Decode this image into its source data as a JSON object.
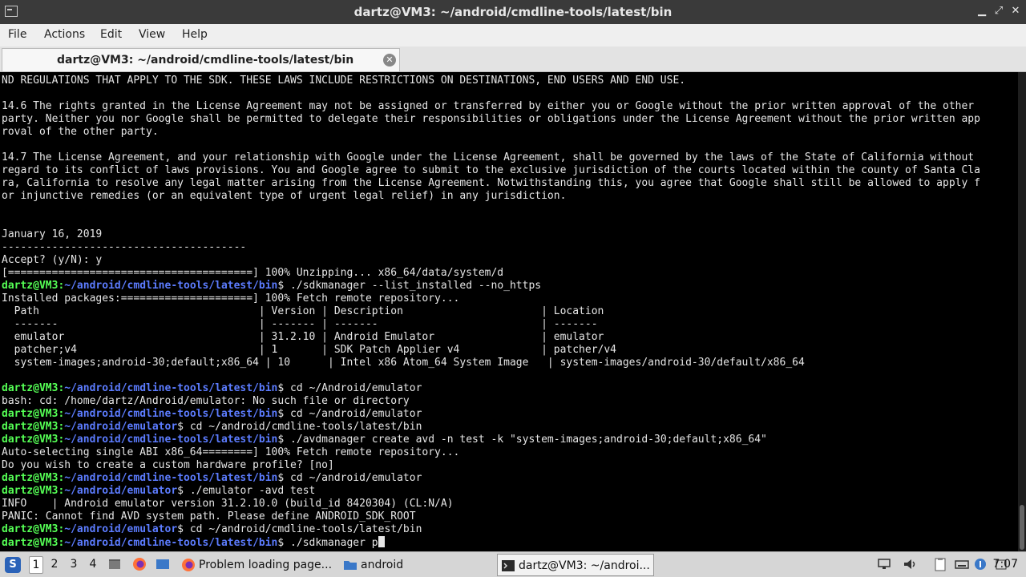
{
  "window": {
    "title": "dartz@VM3: ~/android/cmdline-tools/latest/bin",
    "minimize": "▁",
    "maximize": "⤢",
    "close": "✕"
  },
  "menu": [
    "File",
    "Actions",
    "Edit",
    "View",
    "Help"
  ],
  "tab": {
    "label": "dartz@VM3: ~/android/cmdline-tools/latest/bin",
    "close": "✕"
  },
  "terminal": {
    "lines": [
      {
        "text": "ND REGULATIONS THAT APPLY TO THE SDK. THESE LAWS INCLUDE RESTRICTIONS ON DESTINATIONS, END USERS AND END USE."
      },
      {
        "text": ""
      },
      {
        "text": "14.6 The rights granted in the License Agreement may not be assigned or transferred by either you or Google without the prior written approval of the other"
      },
      {
        "text": "party. Neither you nor Google shall be permitted to delegate their responsibilities or obligations under the License Agreement without the prior written app"
      },
      {
        "text": "roval of the other party."
      },
      {
        "text": ""
      },
      {
        "text": "14.7 The License Agreement, and your relationship with Google under the License Agreement, shall be governed by the laws of the State of California without"
      },
      {
        "text": "regard to its conflict of laws provisions. You and Google agree to submit to the exclusive jurisdiction of the courts located within the county of Santa Cla"
      },
      {
        "text": "ra, California to resolve any legal matter arising from the License Agreement. Notwithstanding this, you agree that Google shall still be allowed to apply f"
      },
      {
        "text": "or injunctive remedies (or an equivalent type of urgent legal relief) in any jurisdiction."
      },
      {
        "text": ""
      },
      {
        "text": ""
      },
      {
        "text": "January 16, 2019"
      },
      {
        "text": "---------------------------------------"
      },
      {
        "text": "Accept? (y/N): y"
      },
      {
        "text": "[=======================================] 100% Unzipping... x86_64/data/system/d"
      },
      {
        "prompt": "dartz@VM3",
        "path": "~/android/cmdline-tools/latest/bin",
        "text": "$ ./sdkmanager --list_installed --no_https"
      },
      {
        "text": "Installed packages:=====================] 100% Fetch remote repository..."
      },
      {
        "text": "  Path                                   | Version | Description                      | Location"
      },
      {
        "text": "  -------                                | ------- | -------                          | -------"
      },
      {
        "text": "  emulator                               | 31.2.10 | Android Emulator                 | emulator"
      },
      {
        "text": "  patcher;v4                             | 1       | SDK Patch Applier v4             | patcher/v4"
      },
      {
        "text": "  system-images;android-30;default;x86_64 | 10      | Intel x86 Atom_64 System Image   | system-images/android-30/default/x86_64"
      },
      {
        "text": ""
      },
      {
        "prompt": "dartz@VM3",
        "path": "~/android/cmdline-tools/latest/bin",
        "text": "$ cd ~/Android/emulator"
      },
      {
        "text": "bash: cd: /home/dartz/Android/emulator: No such file or directory"
      },
      {
        "prompt": "dartz@VM3",
        "path": "~/android/cmdline-tools/latest/bin",
        "text": "$ cd ~/android/emulator"
      },
      {
        "prompt": "dartz@VM3",
        "path": "~/android/emulator",
        "text": "$ cd ~/android/cmdline-tools/latest/bin"
      },
      {
        "prompt": "dartz@VM3",
        "path": "~/android/cmdline-tools/latest/bin",
        "text": "$ ./avdmanager create avd -n test -k \"system-images;android-30;default;x86_64\""
      },
      {
        "text": "Auto-selecting single ABI x86_64========] 100% Fetch remote repository..."
      },
      {
        "text": "Do you wish to create a custom hardware profile? [no]"
      },
      {
        "prompt": "dartz@VM3",
        "path": "~/android/cmdline-tools/latest/bin",
        "text": "$ cd ~/android/emulator"
      },
      {
        "prompt": "dartz@VM3",
        "path": "~/android/emulator",
        "text": "$ ./emulator -avd test"
      },
      {
        "text": "INFO    | Android emulator version 31.2.10.0 (build_id 8420304) (CL:N/A)"
      },
      {
        "text": "PANIC: Cannot find AVD system path. Please define ANDROID_SDK_ROOT"
      },
      {
        "prompt": "dartz@VM3",
        "path": "~/android/emulator",
        "text": "$ cd ~/android/cmdline-tools/latest/bin"
      },
      {
        "prompt": "dartz@VM3",
        "path": "~/android/cmdline-tools/latest/bin",
        "text": "$ ./sdkmanager p",
        "cursor": true
      }
    ]
  },
  "taskbar": {
    "start_icon": "lxqt-menu-icon",
    "start_glyph": "S",
    "workspaces": [
      "1",
      "2",
      "3",
      "4"
    ],
    "active_workspace": "1",
    "tasks": [
      {
        "label": "Problem loading page...",
        "icon": "firefox-icon"
      },
      {
        "label": "android",
        "icon": "folder-icon"
      },
      {
        "label": "dartz@VM3: ~/androi...",
        "icon": "terminal-icon",
        "active": true
      }
    ],
    "clock": "7:07"
  },
  "colors": {
    "prompt": "#55ff55",
    "path": "#5c7cff",
    "terminal_bg": "#000000",
    "terminal_fg": "#e6e6e6"
  }
}
